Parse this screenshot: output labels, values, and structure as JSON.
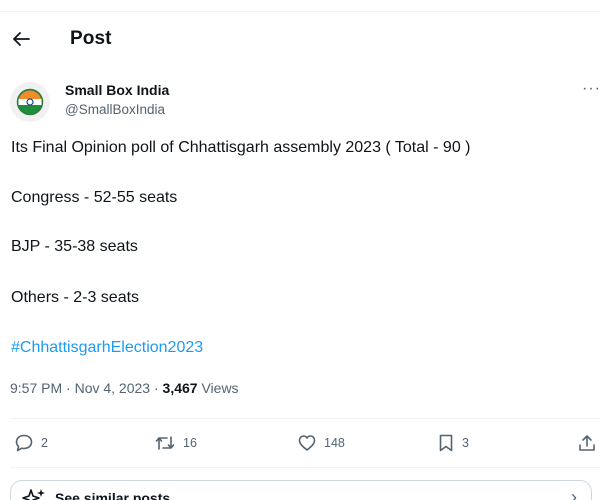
{
  "header": {
    "title": "Post"
  },
  "post": {
    "author": {
      "name": "Small Box India",
      "handle": "@SmallBoxIndia"
    },
    "lines": [
      "Its Final Opinion poll of Chhattisgarh assembly 2023 ( Total - 90 )",
      "Congress - 52-55  seats",
      "BJP - 35-38 seats",
      "Others - 2-3 seats"
    ],
    "hashtag": "#ChhattisgarhElection2023",
    "timestamp": "9:57 PM · Nov 4, 2023 · ",
    "views_count": "3,467",
    "views_label": " Views",
    "more_label": "···"
  },
  "actions": {
    "replies": "2",
    "reposts": "16",
    "likes": "148",
    "bookmarks": "3"
  },
  "see_similar": {
    "label": "See similar posts"
  },
  "icons": {
    "back": "arrow-left-icon",
    "reply": "speech-bubble-icon",
    "repost": "repost-arrows-icon",
    "like": "heart-icon",
    "bookmark": "bookmark-icon",
    "share": "share-upload-icon",
    "sparkle": "sparkle-icon",
    "chevron": "chevron-right-icon"
  },
  "colors": {
    "text": "#0f1419",
    "secondary": "#536471",
    "link": "#1d9bf0",
    "divider": "#eff3f4"
  }
}
